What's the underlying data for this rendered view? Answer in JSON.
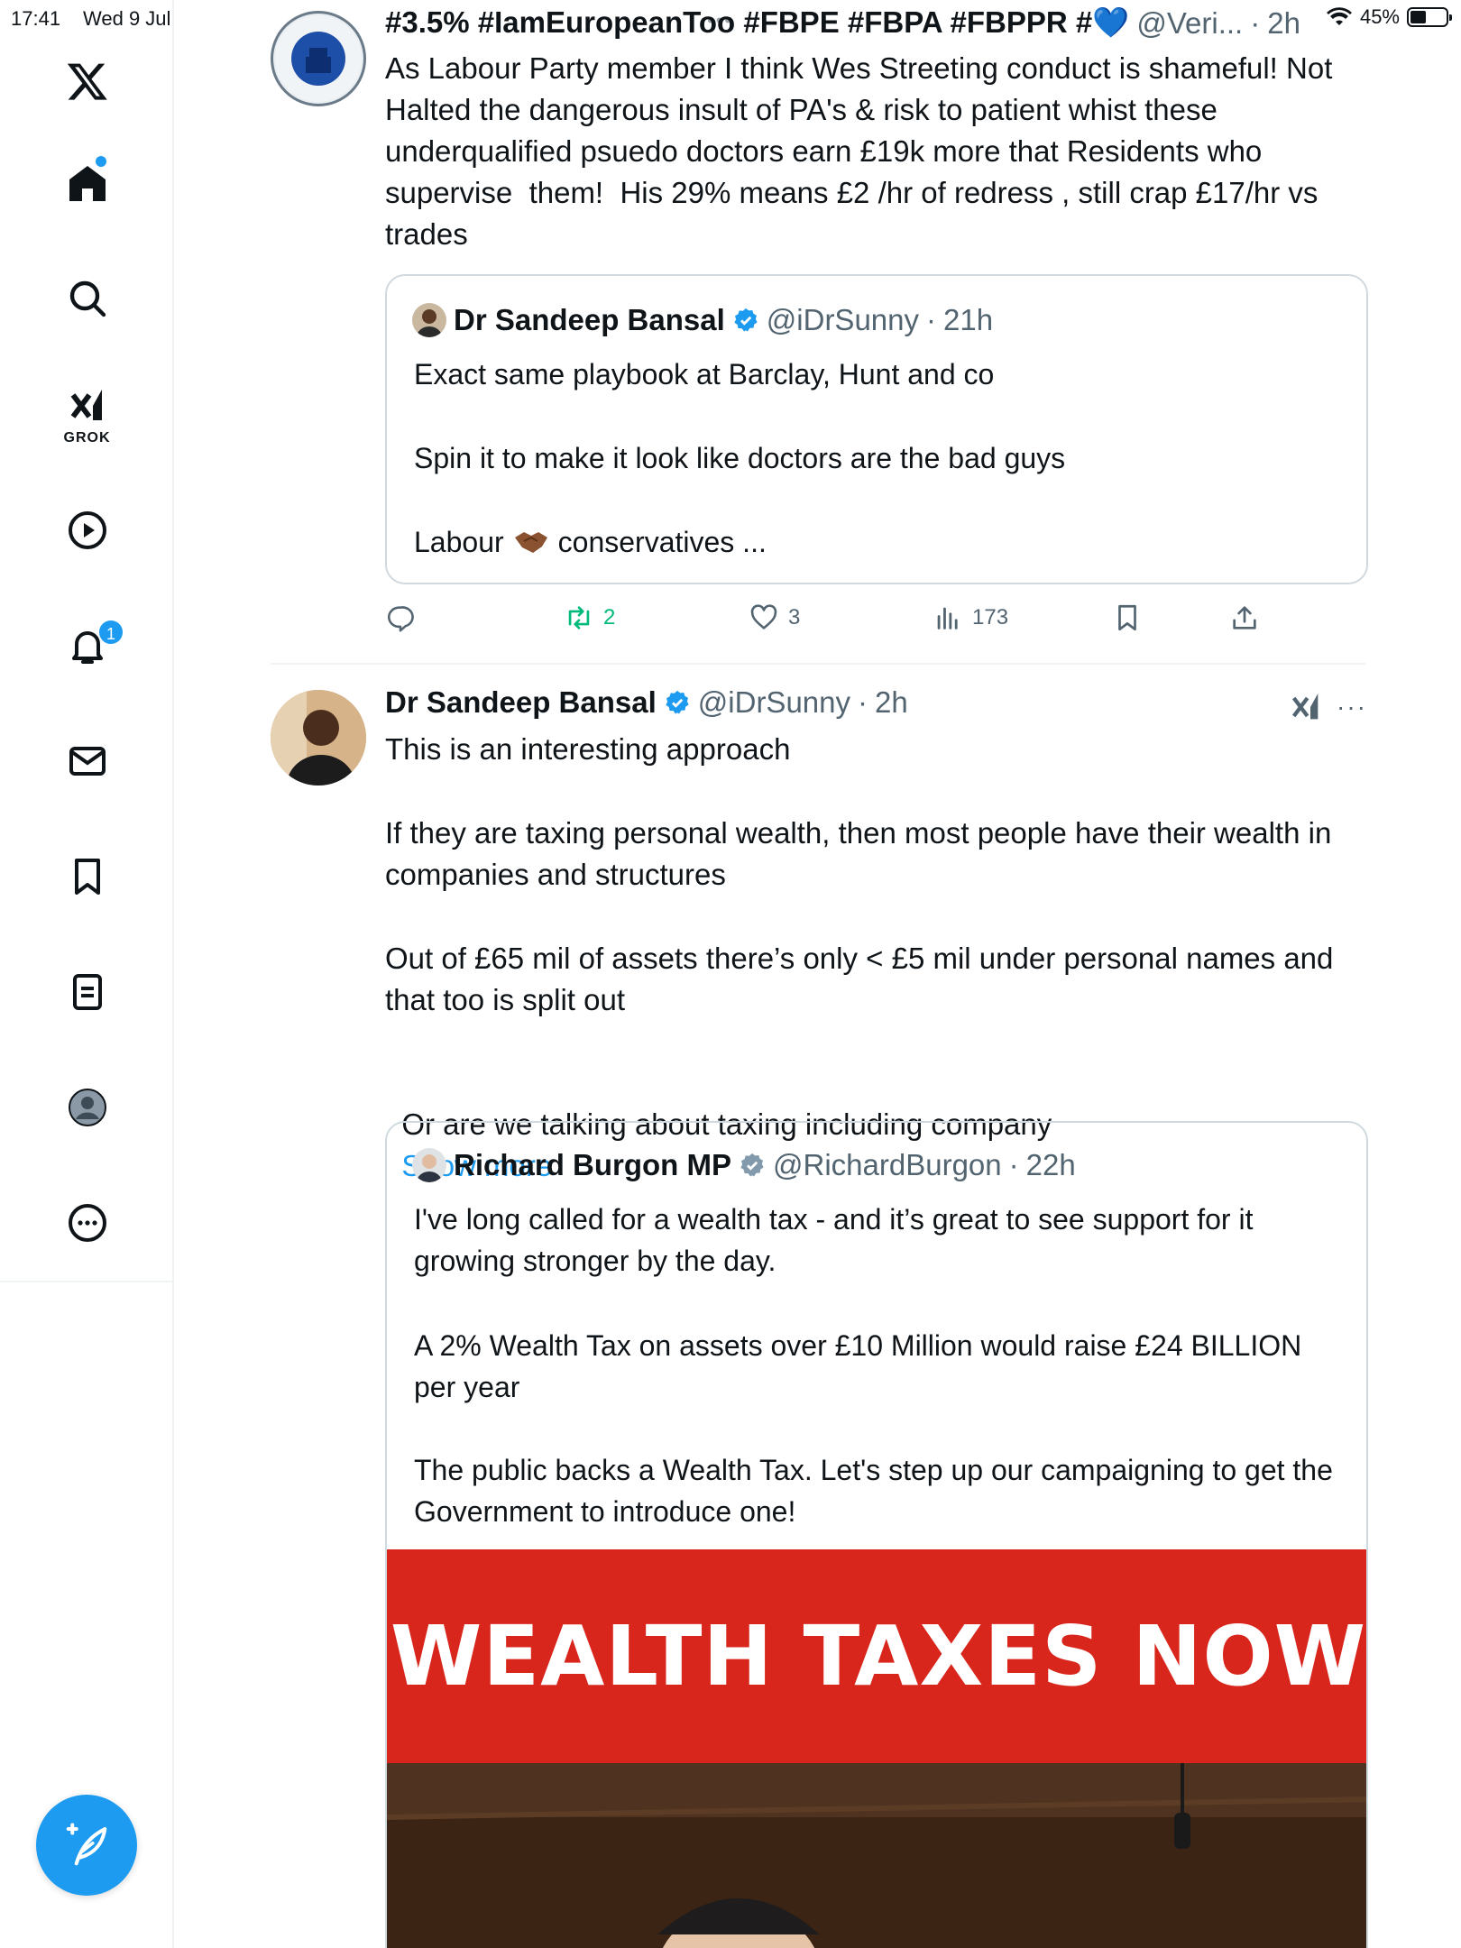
{
  "status": {
    "time": "17:41",
    "date": "Wed 9 Jul",
    "battery": "45%",
    "battery_level": 0.45
  },
  "sidebar": {
    "items": [
      "x-logo",
      "home",
      "search",
      "grok",
      "video",
      "notifications",
      "messages",
      "bookmarks",
      "lists",
      "profile",
      "more"
    ],
    "grok_label": "GROK",
    "notification_count": "1"
  },
  "tweet1": {
    "header": "#3.5% #IamEuropeanToo #FBPE #FBPA #FBPPR #💙",
    "handle": "@Veri...",
    "sep": "·",
    "ago": "2h",
    "text": "As Labour Party member I think Wes Streeting conduct is shameful! Not Halted the dangerous insult of PA's & risk to patient whist these underqualified psuedo doctors earn £19k more that Residents who supervise  them!  His 29% means £2 /hr of redress , still crap £17/hr vs trades",
    "quote": {
      "name": "Dr Sandeep Bansal",
      "handle": "@iDrSunny",
      "sep": "·",
      "ago": "21h",
      "line1": "Exact same playbook at Barclay, Hunt and co",
      "line2": "Spin it to make it look like doctors are the bad guys",
      "line3a": "Labour",
      "line3b": "conservatives ..."
    },
    "stats": {
      "retweets": "2",
      "likes": "3",
      "views": "173"
    }
  },
  "tweet2": {
    "name": "Dr Sandeep Bansal",
    "handle": "@iDrSunny",
    "sep": "·",
    "ago": "2h",
    "p1": "This is an interesting approach",
    "p2": "If they are taxing personal wealth, then most people have their wealth in companies and structures",
    "p3": "Out of £65 mil of assets there’s only < £5 mil under personal names and that too is split out",
    "p4": "Or are we talking about taxing including company",
    "show_more": "Show more",
    "quote": {
      "name": "Richard Burgon MP",
      "handle": "@RichardBurgon",
      "sep": "·",
      "ago": "22h",
      "p1": "I've long called for a wealth tax - and it’s great to see support for it growing stronger by the day.",
      "p2": "A 2% Wealth Tax on assets over £10 Million would raise £24 BILLION per year",
      "p3": "The public backs a Wealth Tax. Let's step up our campaigning to get the Government to introduce one!",
      "banner": "WEALTH TAXES NOW"
    }
  },
  "colors": {
    "accent": "#1d9bf0",
    "retweet": "#00ba7c",
    "banner": "#d9261c",
    "muted": "#536471",
    "border": "#cfd9de"
  }
}
